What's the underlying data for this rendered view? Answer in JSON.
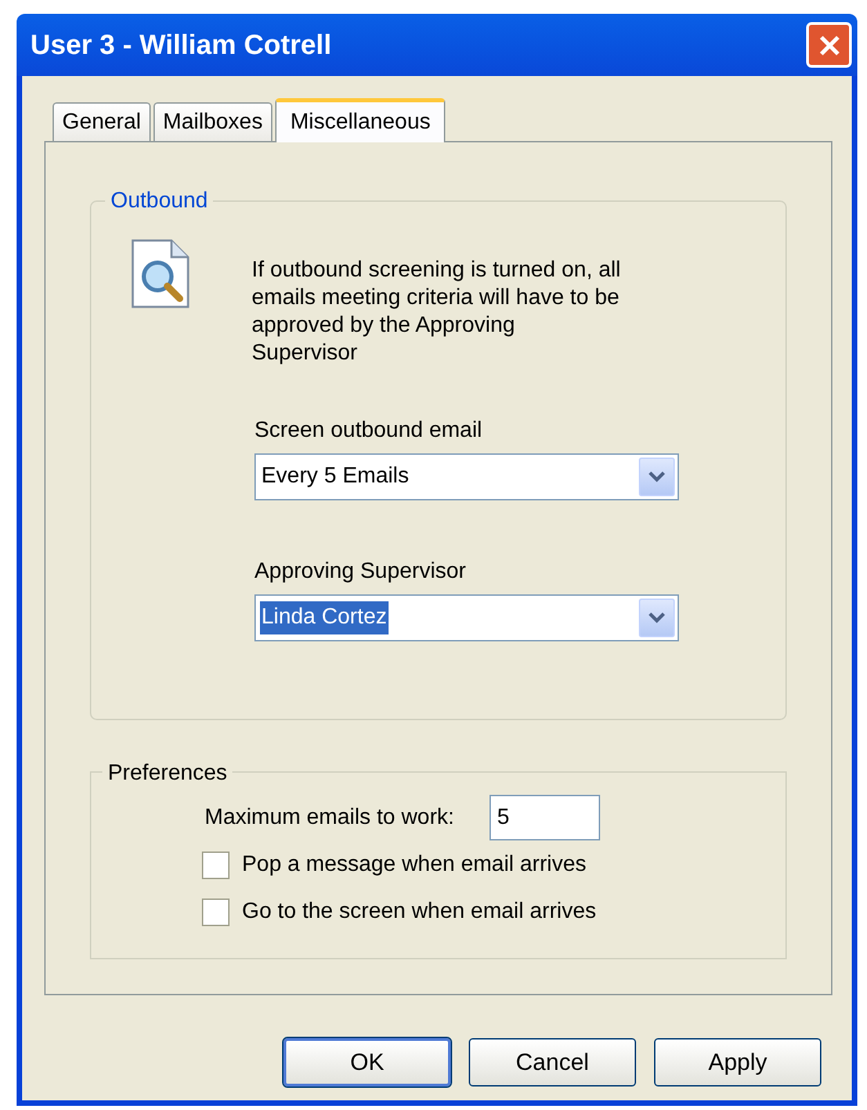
{
  "window": {
    "title": "User 3 - William Cotrell"
  },
  "tabs": [
    {
      "label": "General",
      "selected": false
    },
    {
      "label": "Mailboxes",
      "selected": false
    },
    {
      "label": "Miscellaneous",
      "selected": true
    }
  ],
  "outbound": {
    "legend": "Outbound",
    "description": "If outbound screening is turned on, all emails meeting criteria will have to be approved by the Approving Supervisor",
    "fields": [
      {
        "label": "Screen outbound email",
        "value": "Every 5 Emails",
        "highlighted": false
      },
      {
        "label": "Approving Supervisor",
        "value": "Linda Cortez",
        "highlighted": true
      }
    ]
  },
  "preferences": {
    "legend": "Preferences",
    "max_label": "Maximum emails to work:",
    "max_value": "5",
    "checkboxes": [
      {
        "label": "Pop a message when email arrives",
        "checked": false
      },
      {
        "label": "Go to the screen when email arrives",
        "checked": false
      }
    ]
  },
  "buttons": [
    {
      "label": "OK",
      "default": true
    },
    {
      "label": "Cancel",
      "default": false
    },
    {
      "label": "Apply",
      "default": false
    }
  ]
}
